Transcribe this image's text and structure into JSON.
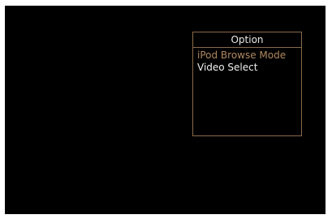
{
  "option_menu": {
    "title": "Option",
    "items": [
      {
        "label": "iPod Browse Mode",
        "state": "highlighted"
      },
      {
        "label": "Video Select",
        "state": "normal"
      }
    ]
  },
  "colors": {
    "background": "#000000",
    "border": "#8a6a4a",
    "highlight_text": "#b08860",
    "normal_text": "#f0f0f0"
  }
}
